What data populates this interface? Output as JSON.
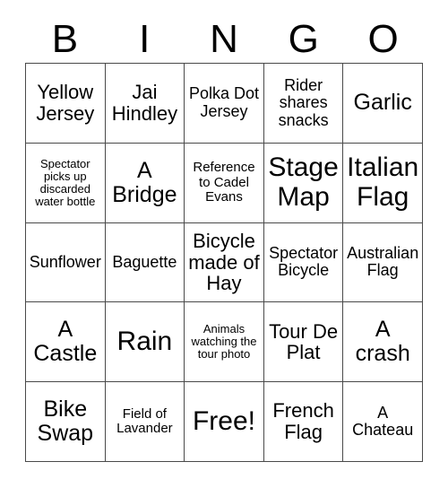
{
  "card": {
    "type": "bingo-card",
    "theme": "Tour de France",
    "header_letters": [
      "B",
      "I",
      "N",
      "G",
      "O"
    ],
    "columns": 5,
    "rows": 5,
    "colors": {
      "background": "#ffffff",
      "text": "#000000",
      "border": "#4a4a4a"
    },
    "cells": [
      [
        {
          "text": "Yellow Jersey",
          "size": "lg",
          "free": false
        },
        {
          "text": "Jai Hindley",
          "size": "lg",
          "free": false
        },
        {
          "text": "Polka Dot Jersey",
          "size": "md",
          "free": false
        },
        {
          "text": "Rider shares snacks",
          "size": "md",
          "free": false
        },
        {
          "text": "Garlic",
          "size": "xl",
          "free": false
        }
      ],
      [
        {
          "text": "Spectator picks up discarded water bottle",
          "size": "xs",
          "free": false
        },
        {
          "text": "A Bridge",
          "size": "xl",
          "free": false
        },
        {
          "text": "Reference to Cadel Evans",
          "size": "sm",
          "free": false
        },
        {
          "text": "Stage Map",
          "size": "xxl",
          "free": false
        },
        {
          "text": "Italian Flag",
          "size": "xxl",
          "free": false
        }
      ],
      [
        {
          "text": "Sunflower",
          "size": "md",
          "free": false
        },
        {
          "text": "Baguette",
          "size": "md",
          "free": false
        },
        {
          "text": "Bicycle made of Hay",
          "size": "lg",
          "free": false
        },
        {
          "text": "Spectator Bicycle",
          "size": "md",
          "free": false
        },
        {
          "text": "Australian Flag",
          "size": "md",
          "free": false
        }
      ],
      [
        {
          "text": "A Castle",
          "size": "xl",
          "free": false
        },
        {
          "text": "Rain",
          "size": "xxl",
          "free": false
        },
        {
          "text": "Animals watching the tour photo",
          "size": "xs",
          "free": false
        },
        {
          "text": "Tour De Plat",
          "size": "lg",
          "free": false
        },
        {
          "text": "A crash",
          "size": "xl",
          "free": false
        }
      ],
      [
        {
          "text": "Bike Swap",
          "size": "xl",
          "free": false
        },
        {
          "text": "Field of Lavander",
          "size": "sm",
          "free": false
        },
        {
          "text": "Free!",
          "size": "xxl",
          "free": true
        },
        {
          "text": "French Flag",
          "size": "lg",
          "free": false
        },
        {
          "text": "A Chateau",
          "size": "md",
          "free": false
        }
      ]
    ]
  }
}
